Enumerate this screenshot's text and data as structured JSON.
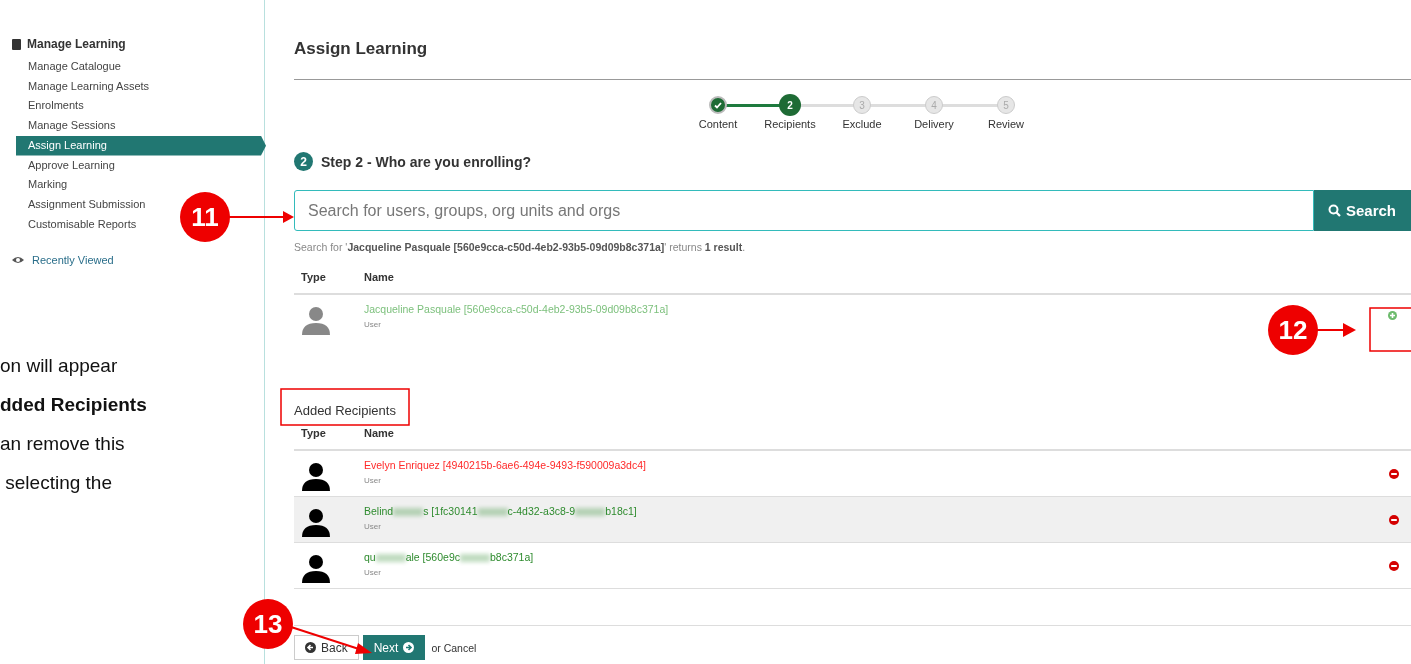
{
  "sidebar": {
    "heading": "Manage Learning",
    "items": [
      {
        "label": "Manage Catalogue",
        "selected": false
      },
      {
        "label": "Manage Learning Assets",
        "selected": false
      },
      {
        "label": "Enrolments",
        "selected": false
      },
      {
        "label": "Manage Sessions",
        "selected": false
      },
      {
        "label": "Assign Learning",
        "selected": true
      },
      {
        "label": "Approve Learning",
        "selected": false
      },
      {
        "label": "Marking",
        "selected": false
      },
      {
        "label": "Assignment Submission",
        "selected": false
      },
      {
        "label": "Customisable Reports",
        "selected": false
      }
    ],
    "recently_viewed": "Recently Viewed"
  },
  "note": {
    "lines": [
      "on will appear",
      "**dded Recipients**",
      "an remove this",
      " selecting the"
    ]
  },
  "page_title": "Assign Learning",
  "steps": [
    {
      "label": "Content",
      "done": true,
      "selected": false
    },
    {
      "number": "2",
      "label": "Recipients",
      "done": false,
      "selected": true
    },
    {
      "number": "3",
      "label": "Exclude",
      "done": false,
      "selected": false
    },
    {
      "number": "4",
      "label": "Delivery",
      "done": false,
      "selected": false
    },
    {
      "number": "5",
      "label": "Review",
      "done": false,
      "selected": false
    }
  ],
  "step_heading": {
    "number": "2",
    "text": "Step 2 - Who are you enrolling?"
  },
  "search": {
    "placeholder": "Search for users, groups, org units and orgs",
    "button": "Search"
  },
  "result_summary": "Search for '**Jacqueline Pasquale [560e9cca-c50d-4eb2-93b5-09d09b8c371a]**' returns **1 result**.",
  "results": {
    "columns": [
      "Type",
      "Name"
    ],
    "rows": [
      {
        "segments": [
          "Jacqueline Pasquale [560e9cca-c50d-4eb2-93b5-09d09b8c371a]"
        ],
        "type": "User"
      }
    ]
  },
  "added": {
    "title": "Added Recipients",
    "columns": [
      "Type",
      "Name"
    ],
    "rows": [
      {
        "segments": [
          "Evelyn Enriquez [4940215b-6ae6-494e-9493-f590009a3dc4]"
        ],
        "type": "User",
        "color": "#ff2a2a"
      },
      {
        "segments": [
          "Belind",
          "s [1fc30141",
          "c-4d32-a3c8-9",
          "b18c1]"
        ],
        "type": "User",
        "color": "#2e8b2e"
      },
      {
        "segments": [
          "qu",
          "ale [560e9c",
          "b8c371a]"
        ],
        "type": "User",
        "color": "#2e8b2e"
      }
    ]
  },
  "footer": {
    "back": "Back",
    "next": "Next",
    "cancel": "or Cancel"
  },
  "callouts": [
    {
      "label": "11"
    },
    {
      "label": "12"
    },
    {
      "label": "13"
    }
  ]
}
